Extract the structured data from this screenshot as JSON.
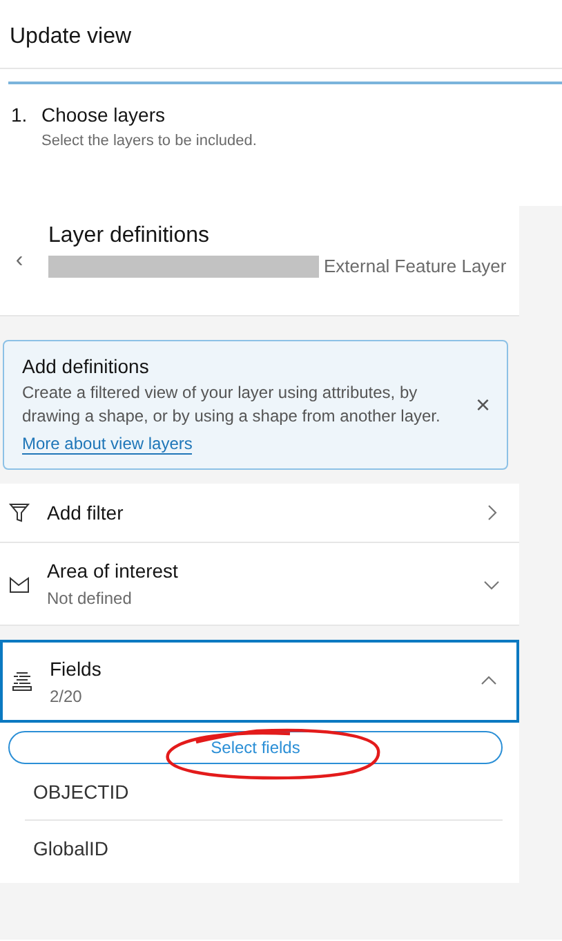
{
  "header": {
    "title": "Update view"
  },
  "step": {
    "number": "1.",
    "title": "Choose layers",
    "description": "Select the layers to be included."
  },
  "panel": {
    "back": "‹",
    "title": "Layer definitions",
    "subtitle": "External Feature Layer",
    "redacted": true
  },
  "notice": {
    "title": "Add definitions",
    "text": "Create a filtered view of your layer using attributes, by drawing a shape, or by using a shape from another layer.",
    "link": "More about view layers",
    "close": "×"
  },
  "items": [
    {
      "kind": "nav",
      "label": "Add filter"
    },
    {
      "kind": "accordion",
      "label": "Area of interest",
      "description": "Not defined",
      "expanded": false,
      "focused": false
    },
    {
      "kind": "accordion",
      "label": "Fields",
      "description": "2/20",
      "expanded": true,
      "focused": true,
      "button": {
        "label": "Select fields",
        "circled": true
      },
      "fields": [
        "OBJECTID",
        "GlobalID"
      ]
    }
  ]
}
